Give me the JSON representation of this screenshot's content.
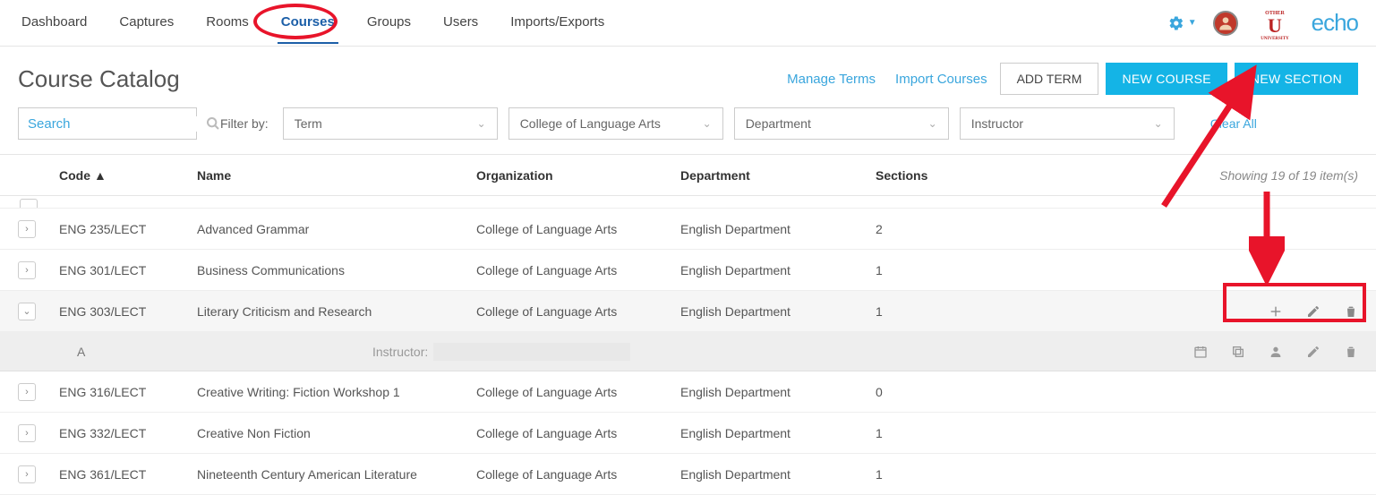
{
  "nav": {
    "tabs": [
      "Dashboard",
      "Captures",
      "Rooms",
      "Courses",
      "Groups",
      "Users",
      "Imports/Exports"
    ],
    "active_index": 3,
    "logo_text": "echo"
  },
  "header": {
    "title": "Course Catalog",
    "links": {
      "manage_terms": "Manage Terms",
      "import_courses": "Import Courses"
    },
    "buttons": {
      "add_term": "ADD TERM",
      "new_course": "NEW COURSE",
      "new_section": "NEW SECTION"
    }
  },
  "filters": {
    "search_placeholder": "Search",
    "label": "Filter by:",
    "term": "Term",
    "organization": "College of Language Arts",
    "department": "Department",
    "instructor": "Instructor",
    "clear": "Clear All"
  },
  "table": {
    "headers": {
      "code": "Code",
      "name": "Name",
      "organization": "Organization",
      "department": "Department",
      "sections": "Sections"
    },
    "showing": "Showing 19 of 19 item(s)",
    "rows": [
      {
        "code": "ENG 235/LECT",
        "name": "Advanced Grammar",
        "organization": "College of Language Arts",
        "department": "English Department",
        "sections": "2",
        "expanded": false
      },
      {
        "code": "ENG 301/LECT",
        "name": "Business Communications",
        "organization": "College of Language Arts",
        "department": "English Department",
        "sections": "1",
        "expanded": false
      },
      {
        "code": "ENG 303/LECT",
        "name": "Literary Criticism and Research",
        "organization": "College of Language Arts",
        "department": "English Department",
        "sections": "1",
        "expanded": true
      },
      {
        "code": "ENG 316/LECT",
        "name": "Creative Writing: Fiction Workshop 1",
        "organization": "College of Language Arts",
        "department": "English Department",
        "sections": "0",
        "expanded": false
      },
      {
        "code": "ENG 332/LECT",
        "name": "Creative Non Fiction",
        "organization": "College of Language Arts",
        "department": "English Department",
        "sections": "1",
        "expanded": false
      },
      {
        "code": "ENG 361/LECT",
        "name": "Nineteenth Century American Literature",
        "organization": "College of Language Arts",
        "department": "English Department",
        "sections": "1",
        "expanded": false
      }
    ],
    "expanded_section": {
      "label": "A",
      "instructor_label": "Instructor:",
      "instructor_value": ""
    }
  }
}
